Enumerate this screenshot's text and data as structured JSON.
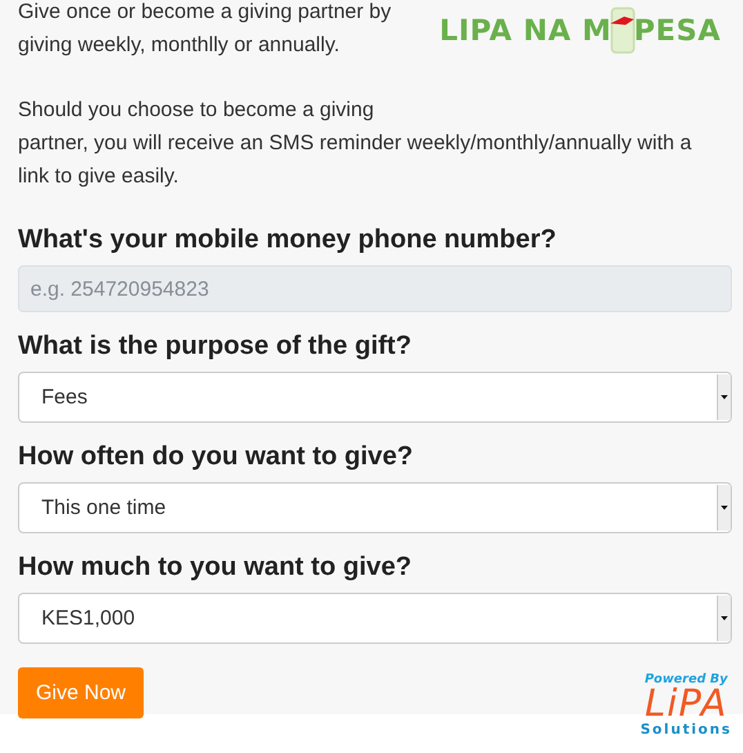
{
  "intro": [
    "Give once or become a giving partner by\ngiving weekly, monthlly or annually.",
    "Should you choose to become a giving\npartner, you will receive an SMS reminder weekly/monthly/annually with a link to give easily."
  ],
  "logo": {
    "left": "LIPA NA M",
    "right": "PESA"
  },
  "fields": [
    {
      "kind": "input",
      "label": "What's your mobile money phone number?",
      "placeholder": "e.g. 254720954823"
    },
    {
      "kind": "select",
      "label": "What is the purpose of the gift?",
      "value": "Fees"
    },
    {
      "kind": "select",
      "label": "How often do you want to give?",
      "value": "This one time"
    },
    {
      "kind": "select",
      "label": "How much to you want to give?",
      "value": "KES1,000"
    }
  ],
  "submit": "Give Now",
  "powered": {
    "top": "Powered By",
    "brand": "LiPA",
    "bottom": "Solutions"
  }
}
